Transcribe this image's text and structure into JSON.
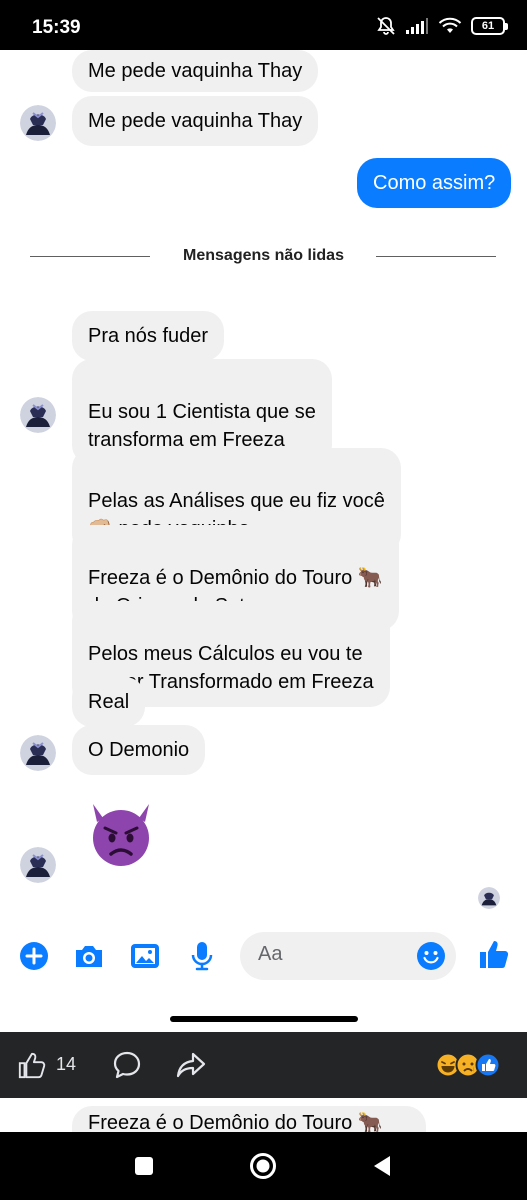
{
  "status_bar": {
    "time": "15:39",
    "battery": "61",
    "icons": [
      "mute-bell-icon",
      "signal-icon",
      "wifi-icon",
      "battery-icon"
    ]
  },
  "chat": {
    "messages": [
      {
        "text": "Me pede vaquinha Thay",
        "sender": "other"
      },
      {
        "text": "Me pede vaquinha Thay",
        "sender": "other"
      },
      {
        "text": "Como assim?",
        "sender": "me"
      },
      {
        "text": "Pra nós fuder",
        "sender": "other"
      },
      {
        "text": "Eu sou 1 Cientista que se\ntransforma em Freeza",
        "sender": "other"
      },
      {
        "text": "Pelas as Análises que eu fiz você\n👊🏼 pede vaquinha",
        "sender": "other"
      },
      {
        "text": "Freeza é o Demônio do Touro 🐂\nda Origem do Satanas",
        "sender": "other"
      },
      {
        "text": "Pelos meus Cálculos eu vou te\ncomer Transformado em Freeza",
        "sender": "other"
      },
      {
        "text": "Real",
        "sender": "other"
      },
      {
        "text": "O Demonio",
        "sender": "other"
      }
    ],
    "unread_divider": "Mensagens não lidas",
    "big_emoji": "angry-devil-emoji"
  },
  "composer": {
    "placeholder": "Aa",
    "icons": [
      "plus-icon",
      "camera-icon",
      "gallery-icon",
      "microphone-icon",
      "emoji-icon",
      "thumbs-up-icon"
    ]
  },
  "facebook_bar": {
    "like_count": "14",
    "reactions": [
      "haha",
      "sad",
      "like"
    ],
    "icons": [
      "like-icon",
      "comment-icon",
      "share-icon"
    ]
  },
  "peek": {
    "text": "Freeza é o Demônio do Touro 🐂"
  },
  "colors": {
    "accent": "#0a7cff",
    "bubble_gray": "#f0f0f0",
    "dark_bar": "#242526"
  }
}
